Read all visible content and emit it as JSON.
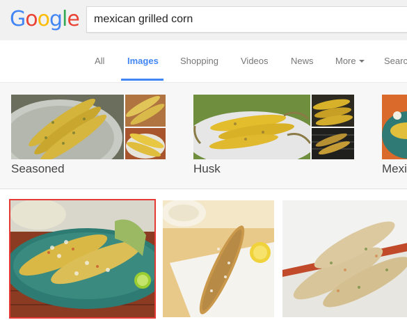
{
  "logo": {
    "letters": [
      "G",
      "o",
      "o",
      "g",
      "l",
      "e"
    ],
    "colors": [
      "#4285f4",
      "#ea4335",
      "#fbbc05",
      "#4285f4",
      "#34a853",
      "#ea4335"
    ]
  },
  "search": {
    "query": "mexican grilled corn"
  },
  "tabs": [
    {
      "label": "All"
    },
    {
      "label": "Images"
    },
    {
      "label": "Shopping"
    },
    {
      "label": "Videos"
    },
    {
      "label": "News"
    },
    {
      "label": "More"
    },
    {
      "label": "Searc"
    }
  ],
  "related": [
    {
      "label": "Seasoned"
    },
    {
      "label": "Husk"
    },
    {
      "label": "Mexi"
    }
  ],
  "colors": {
    "accent": "#4285f4",
    "selected": "#e53935"
  }
}
